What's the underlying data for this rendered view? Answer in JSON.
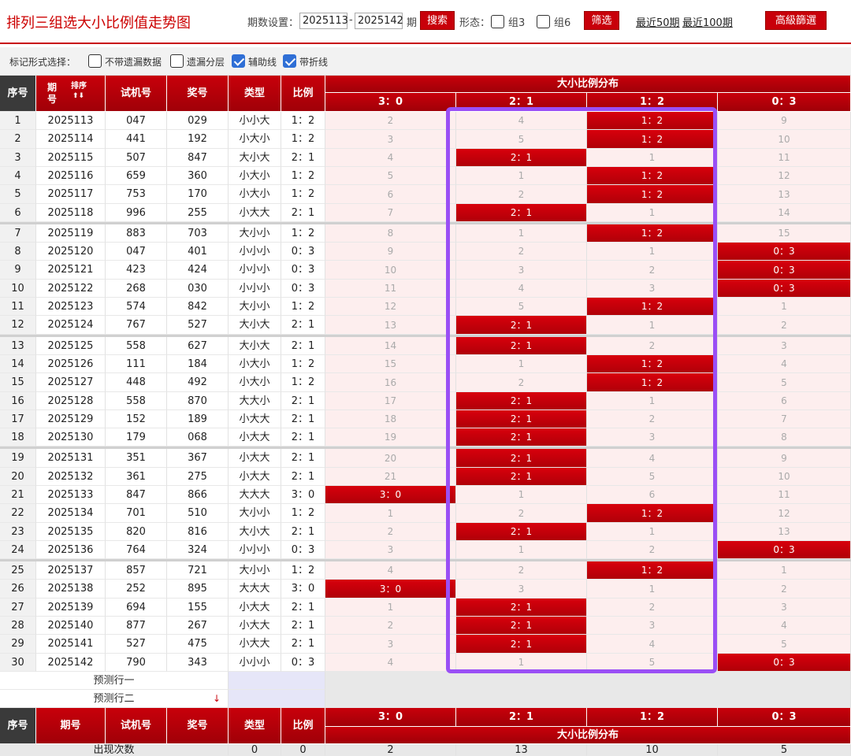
{
  "header": {
    "title": "排列三组选大小比例值走势图",
    "period_label": "期数设置：",
    "period_from": "2025113",
    "period_dash": "-",
    "period_to": "2025142",
    "period_unit": "期",
    "search_label": "搜索",
    "form_label": "形态：",
    "group3_label": "组3",
    "group6_label": "组6",
    "filter_label": "筛选",
    "recent50_label": "最近50期",
    "recent100_label": "最近100期",
    "advanced_label": "高級篩選"
  },
  "toolbar": {
    "label": "标记形式选择：",
    "options": [
      {
        "label": "不带遗漏数据",
        "checked": false
      },
      {
        "label": "遗漏分层",
        "checked": false
      },
      {
        "label": "辅助线",
        "checked": true
      },
      {
        "label": "带折线",
        "checked": true
      }
    ]
  },
  "columns": {
    "index": "序号",
    "period": "期号",
    "sort_label": "排序",
    "trial": "试机号",
    "draw": "奖号",
    "type": "类型",
    "ratio": "比例",
    "dist_title": "大小比例分布",
    "dist": [
      "3：0",
      "2：1",
      "1：2",
      "0：3"
    ]
  },
  "rows": [
    {
      "index": "1",
      "period": "2025113",
      "trial": "047",
      "draw": "029",
      "type": "小小大",
      "ratio": "1：2",
      "dist": [
        "2",
        "4",
        "1：2",
        "9"
      ],
      "hit": 2
    },
    {
      "index": "2",
      "period": "2025114",
      "trial": "441",
      "draw": "192",
      "type": "小大小",
      "ratio": "1：2",
      "dist": [
        "3",
        "5",
        "1：2",
        "10"
      ],
      "hit": 2
    },
    {
      "index": "3",
      "period": "2025115",
      "trial": "507",
      "draw": "847",
      "type": "大小大",
      "ratio": "2：1",
      "dist": [
        "4",
        "2：1",
        "1",
        "11"
      ],
      "hit": 1
    },
    {
      "index": "4",
      "period": "2025116",
      "trial": "659",
      "draw": "360",
      "type": "小大小",
      "ratio": "1：2",
      "dist": [
        "5",
        "1",
        "1：2",
        "12"
      ],
      "hit": 2
    },
    {
      "index": "5",
      "period": "2025117",
      "trial": "753",
      "draw": "170",
      "type": "小大小",
      "ratio": "1：2",
      "dist": [
        "6",
        "2",
        "1：2",
        "13"
      ],
      "hit": 2
    },
    {
      "index": "6",
      "period": "2025118",
      "trial": "996",
      "draw": "255",
      "type": "小大大",
      "ratio": "2：1",
      "dist": [
        "7",
        "2：1",
        "1",
        "14"
      ],
      "hit": 1
    },
    {
      "index": "7",
      "period": "2025119",
      "trial": "883",
      "draw": "703",
      "type": "大小小",
      "ratio": "1：2",
      "dist": [
        "8",
        "1",
        "1：2",
        "15"
      ],
      "hit": 2
    },
    {
      "index": "8",
      "period": "2025120",
      "trial": "047",
      "draw": "401",
      "type": "小小小",
      "ratio": "0：3",
      "dist": [
        "9",
        "2",
        "1",
        "0：3"
      ],
      "hit": 3
    },
    {
      "index": "9",
      "period": "2025121",
      "trial": "423",
      "draw": "424",
      "type": "小小小",
      "ratio": "0：3",
      "dist": [
        "10",
        "3",
        "2",
        "0：3"
      ],
      "hit": 3
    },
    {
      "index": "10",
      "period": "2025122",
      "trial": "268",
      "draw": "030",
      "type": "小小小",
      "ratio": "0：3",
      "dist": [
        "11",
        "4",
        "3",
        "0：3"
      ],
      "hit": 3
    },
    {
      "index": "11",
      "period": "2025123",
      "trial": "574",
      "draw": "842",
      "type": "大小小",
      "ratio": "1：2",
      "dist": [
        "12",
        "5",
        "1：2",
        "1"
      ],
      "hit": 2
    },
    {
      "index": "12",
      "period": "2025124",
      "trial": "767",
      "draw": "527",
      "type": "大小大",
      "ratio": "2：1",
      "dist": [
        "13",
        "2：1",
        "1",
        "2"
      ],
      "hit": 1
    },
    {
      "index": "13",
      "period": "2025125",
      "trial": "558",
      "draw": "627",
      "type": "大小大",
      "ratio": "2：1",
      "dist": [
        "14",
        "2：1",
        "2",
        "3"
      ],
      "hit": 1
    },
    {
      "index": "14",
      "period": "2025126",
      "trial": "111",
      "draw": "184",
      "type": "小大小",
      "ratio": "1：2",
      "dist": [
        "15",
        "1",
        "1：2",
        "4"
      ],
      "hit": 2
    },
    {
      "index": "15",
      "period": "2025127",
      "trial": "448",
      "draw": "492",
      "type": "小大小",
      "ratio": "1：2",
      "dist": [
        "16",
        "2",
        "1：2",
        "5"
      ],
      "hit": 2
    },
    {
      "index": "16",
      "period": "2025128",
      "trial": "558",
      "draw": "870",
      "type": "大大小",
      "ratio": "2：1",
      "dist": [
        "17",
        "2：1",
        "1",
        "6"
      ],
      "hit": 1
    },
    {
      "index": "17",
      "period": "2025129",
      "trial": "152",
      "draw": "189",
      "type": "小大大",
      "ratio": "2：1",
      "dist": [
        "18",
        "2：1",
        "2",
        "7"
      ],
      "hit": 1
    },
    {
      "index": "18",
      "period": "2025130",
      "trial": "179",
      "draw": "068",
      "type": "小大大",
      "ratio": "2：1",
      "dist": [
        "19",
        "2：1",
        "3",
        "8"
      ],
      "hit": 1
    },
    {
      "index": "19",
      "period": "2025131",
      "trial": "351",
      "draw": "367",
      "type": "小大大",
      "ratio": "2：1",
      "dist": [
        "20",
        "2：1",
        "4",
        "9"
      ],
      "hit": 1
    },
    {
      "index": "20",
      "period": "2025132",
      "trial": "361",
      "draw": "275",
      "type": "小大大",
      "ratio": "2：1",
      "dist": [
        "21",
        "2：1",
        "5",
        "10"
      ],
      "hit": 1
    },
    {
      "index": "21",
      "period": "2025133",
      "trial": "847",
      "draw": "866",
      "type": "大大大",
      "ratio": "3：0",
      "dist": [
        "3：0",
        "1",
        "6",
        "11"
      ],
      "hit": 0
    },
    {
      "index": "22",
      "period": "2025134",
      "trial": "701",
      "draw": "510",
      "type": "大小小",
      "ratio": "1：2",
      "dist": [
        "1",
        "2",
        "1：2",
        "12"
      ],
      "hit": 2
    },
    {
      "index": "23",
      "period": "2025135",
      "trial": "820",
      "draw": "816",
      "type": "大小大",
      "ratio": "2：1",
      "dist": [
        "2",
        "2：1",
        "1",
        "13"
      ],
      "hit": 1
    },
    {
      "index": "24",
      "period": "2025136",
      "trial": "764",
      "draw": "324",
      "type": "小小小",
      "ratio": "0：3",
      "dist": [
        "3",
        "1",
        "2",
        "0：3"
      ],
      "hit": 3
    },
    {
      "index": "25",
      "period": "2025137",
      "trial": "857",
      "draw": "721",
      "type": "大小小",
      "ratio": "1：2",
      "dist": [
        "4",
        "2",
        "1：2",
        "1"
      ],
      "hit": 2
    },
    {
      "index": "26",
      "period": "2025138",
      "trial": "252",
      "draw": "895",
      "type": "大大大",
      "ratio": "3：0",
      "dist": [
        "3：0",
        "3",
        "1",
        "2"
      ],
      "hit": 0
    },
    {
      "index": "27",
      "period": "2025139",
      "trial": "694",
      "draw": "155",
      "type": "小大大",
      "ratio": "2：1",
      "dist": [
        "1",
        "2：1",
        "2",
        "3"
      ],
      "hit": 1
    },
    {
      "index": "28",
      "period": "2025140",
      "trial": "877",
      "draw": "267",
      "type": "小大大",
      "ratio": "2：1",
      "dist": [
        "2",
        "2：1",
        "3",
        "4"
      ],
      "hit": 1
    },
    {
      "index": "29",
      "period": "2025141",
      "trial": "527",
      "draw": "475",
      "type": "小大大",
      "ratio": "2：1",
      "dist": [
        "3",
        "2：1",
        "4",
        "5"
      ],
      "hit": 1
    },
    {
      "index": "30",
      "period": "2025142",
      "trial": "790",
      "draw": "343",
      "type": "小小小",
      "ratio": "0：3",
      "dist": [
        "4",
        "1",
        "5",
        "0：3"
      ],
      "hit": 3
    }
  ],
  "predict": {
    "row1_label": "预测行一",
    "row2_label": "预测行二",
    "arrow": "↓"
  },
  "footer": {
    "occurrence_label": "出现次数",
    "occurrence_type": "0",
    "occurrence_ratio": "0",
    "occurrences": [
      "2",
      "13",
      "10",
      "5"
    ]
  },
  "colors": {
    "brand_red": "#c8000a",
    "highlight_purple": "#9a4ff5",
    "miss_bg": "#fdeeee"
  }
}
